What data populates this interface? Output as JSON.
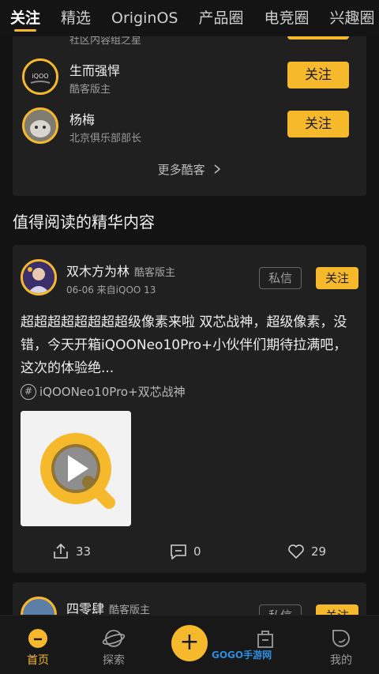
{
  "tabs": [
    {
      "label": "关注"
    },
    {
      "label": "精选"
    },
    {
      "label": "OriginOS"
    },
    {
      "label": "产品圈"
    },
    {
      "label": "电竞圈"
    },
    {
      "label": "兴趣圈"
    }
  ],
  "recommended": {
    "partial_role": "社区内容组之星",
    "users": [
      {
        "name": "生而强悍",
        "role": "酷客版主",
        "follow_label": "关注"
      },
      {
        "name": "杨梅",
        "role": "北京俱乐部部长",
        "follow_label": "关注"
      }
    ],
    "more_label": "更多酷客",
    "partial_follow_label": "关注"
  },
  "section_title": "值得阅读的精华内容",
  "post": {
    "author": "双木方为林",
    "badge": "酷客版主",
    "meta": "06-06 来自iQOO 13",
    "dm_label": "私信",
    "follow_label": "关注",
    "body": "超超超超超超超超级像素来啦 双芯战神，超级像素，没错，今天开箱iQOONeo10Pro+小伙伴们期待拉满吧，这次的体验绝...",
    "topic": "iQOONeo10Pro+双芯战神",
    "shares": "33",
    "comments": "0",
    "likes": "29"
  },
  "post2": {
    "author": "四零肆",
    "badge": "酷客版主",
    "dm_label": "私信",
    "follow_label": "关注"
  },
  "nav": {
    "home": "首页",
    "explore": "探索",
    "plus": "+",
    "mall": "商城",
    "mine": "我的"
  },
  "watermark": "GOGO手游网",
  "colors": {
    "accent": "#f6b92b",
    "background": "#131313",
    "card": "#202020"
  }
}
